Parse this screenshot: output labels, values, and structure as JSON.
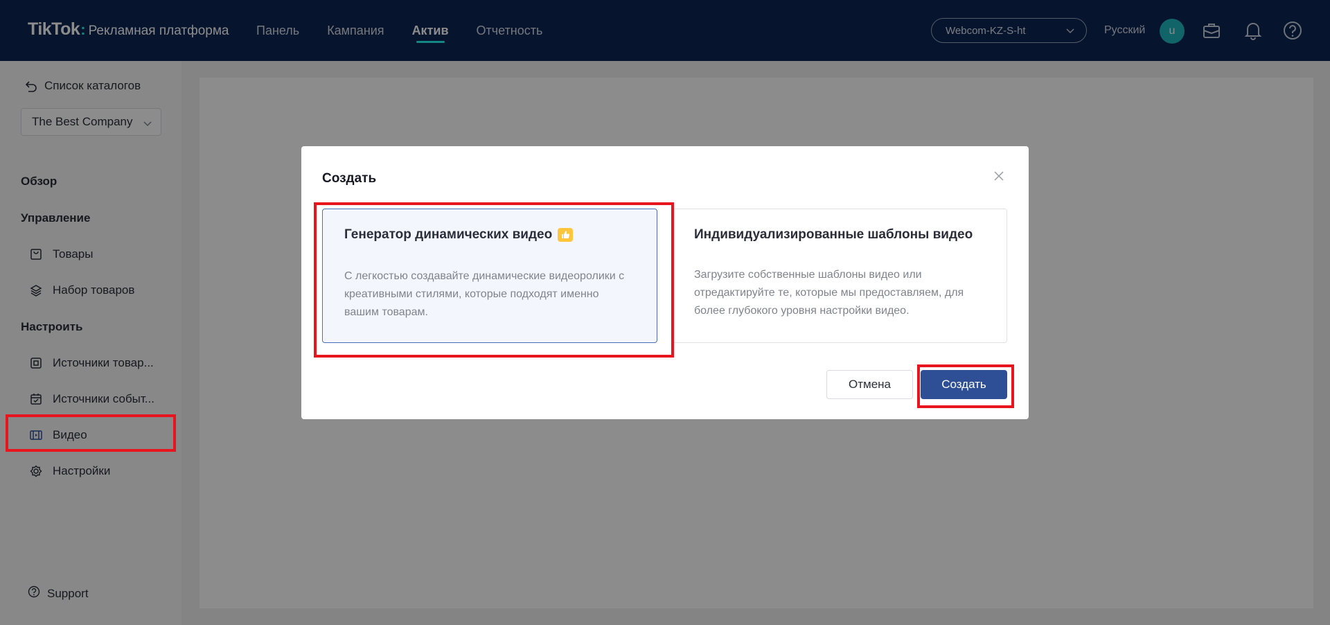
{
  "header": {
    "brand": "TikTok",
    "brand_sub": "Рекламная платформа",
    "nav": [
      {
        "label": "Панель"
      },
      {
        "label": "Кампания"
      },
      {
        "label": "Актив",
        "active": true
      },
      {
        "label": "Отчетность"
      }
    ],
    "account": "Webcom-KZ-S-ht",
    "language": "Русский",
    "avatar_letter": "u",
    "icons": [
      "briefcase-icon",
      "bell-icon",
      "help-icon"
    ]
  },
  "sidebar": {
    "back_label": "Список каталогов",
    "company": "The Best Company",
    "sections": [
      {
        "title": "Обзор"
      },
      {
        "title": "Управление",
        "items": [
          {
            "label": "Товары",
            "icon": "bag-icon"
          },
          {
            "label": "Набор товаров",
            "icon": "layers-icon"
          }
        ]
      },
      {
        "title": "Настроить",
        "items": [
          {
            "label": "Источники товар...",
            "icon": "product-source-icon"
          },
          {
            "label": "Источники событ...",
            "icon": "calendar-icon"
          },
          {
            "label": "Видео",
            "icon": "video-icon"
          },
          {
            "label": "Настройки",
            "icon": "gear-icon"
          }
        ]
      }
    ],
    "support": "Support"
  },
  "modal": {
    "title": "Создать",
    "options": [
      {
        "title": "Генератор динамических видео",
        "description": "С легкостью создавайте динамические видеоролики с креативными стилями, которые подходят именно вашим товарам.",
        "selected": true,
        "badge_icon": "thumbs-up-icon"
      },
      {
        "title": "Индивидуализированные шаблоны видео",
        "description": "Загрузите собственные шаблоны видео или отредактируйте те, которые мы предоставляем, для более глубокого уровня настройки видео.",
        "selected": false
      }
    ],
    "cancel_label": "Отмена",
    "create_label": "Создать"
  },
  "colors": {
    "nav_bg": "#0b2554",
    "accent": "#25f4ee",
    "primary_button": "#2e4f95",
    "highlight": "#e8141e"
  }
}
